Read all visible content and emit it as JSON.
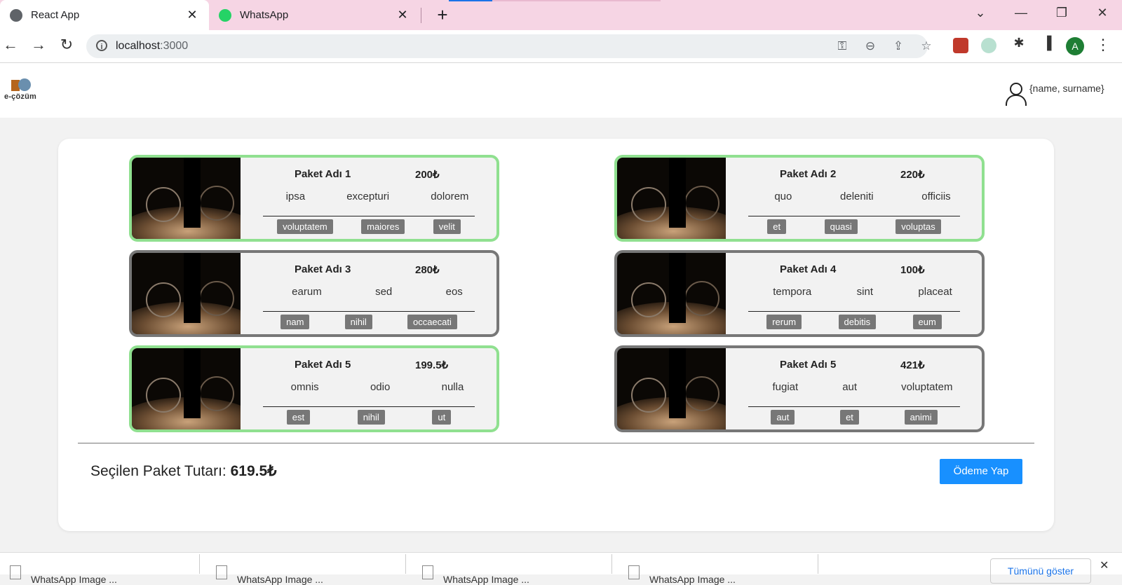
{
  "browser": {
    "tabs": [
      {
        "title": "React App",
        "favicon": "globe-icon",
        "active": true
      },
      {
        "title": "WhatsApp",
        "favicon": "whatsapp-icon",
        "active": false
      }
    ],
    "new_tab": "+",
    "window_controls": {
      "dropdown": "⌄",
      "minimize": "—",
      "restore": "❐",
      "close": "✕"
    },
    "url_host": "localhost",
    "url_port": ":3000",
    "profile_initial": "A"
  },
  "header": {
    "logo_text": "e-çözüm",
    "user_label": "{name, surname}"
  },
  "packages": [
    {
      "name": "Paket Adı 1",
      "price": "200₺",
      "features": [
        "ipsa",
        "excepturi",
        "dolorem"
      ],
      "tags": [
        "voluptatem",
        "maiores",
        "velit"
      ],
      "selected": true
    },
    {
      "name": "Paket Adı 2",
      "price": "220₺",
      "features": [
        "quo",
        "deleniti",
        "officiis"
      ],
      "tags": [
        "et",
        "quasi",
        "voluptas"
      ],
      "selected": true
    },
    {
      "name": "Paket Adı 3",
      "price": "280₺",
      "features": [
        "earum",
        "sed",
        "eos"
      ],
      "tags": [
        "nam",
        "nihil",
        "occaecati"
      ],
      "selected": false
    },
    {
      "name": "Paket Adı 4",
      "price": "100₺",
      "features": [
        "tempora",
        "sint",
        "placeat"
      ],
      "tags": [
        "rerum",
        "debitis",
        "eum"
      ],
      "selected": false
    },
    {
      "name": "Paket Adı 5",
      "price": "199.5₺",
      "features": [
        "omnis",
        "odio",
        "nulla"
      ],
      "tags": [
        "est",
        "nihil",
        "ut"
      ],
      "selected": true
    },
    {
      "name": "Paket Adı 5",
      "price": "421₺",
      "features": [
        "fugiat",
        "aut",
        "voluptatem"
      ],
      "tags": [
        "aut",
        "et",
        "animi"
      ],
      "selected": false
    }
  ],
  "summary": {
    "label": "Seçilen Paket Tutarı:",
    "amount": "619.5₺",
    "pay_button": "Ödeme Yap"
  },
  "downloads": {
    "items": [
      "WhatsApp Image ...",
      "WhatsApp Image ...",
      "WhatsApp Image ...",
      "WhatsApp Image ..."
    ],
    "show_all": "Tümünü göster"
  },
  "colors": {
    "selected_border": "#90e090",
    "unselected_border": "#777777",
    "pay_button": "#1890ff",
    "tab_strip": "#f6d5e4"
  }
}
